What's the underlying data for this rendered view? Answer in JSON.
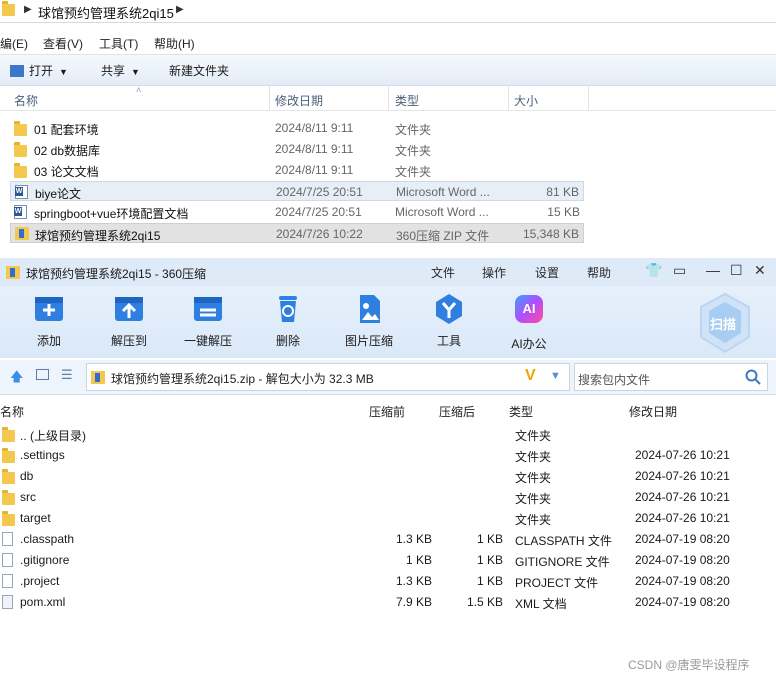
{
  "explorer": {
    "breadcrumb": "球馆预约管理系统2qi15",
    "menu": [
      "编(E)",
      "查看(V)",
      "工具(T)",
      "帮助(H)"
    ],
    "toolbar": {
      "open": "打开",
      "share": "共享",
      "new_folder": "新建文件夹"
    },
    "columns": {
      "name": "名称",
      "date": "修改日期",
      "type": "类型",
      "size": "大小"
    },
    "files": [
      {
        "name": "01 配套环境",
        "date": "2024/8/11 9:11",
        "type": "文件夹",
        "size": "",
        "icon": "folder-icon"
      },
      {
        "name": "02 db数据库",
        "date": "2024/8/11 9:11",
        "type": "文件夹",
        "size": "",
        "icon": "folder-icon"
      },
      {
        "name": "03 论文文档",
        "date": "2024/8/11 9:11",
        "type": "文件夹",
        "size": "",
        "icon": "folder-icon"
      },
      {
        "name": "biye论文",
        "date": "2024/7/25 20:51",
        "type": "Microsoft Word ...",
        "size": "81 KB",
        "icon": "word-doc-icon"
      },
      {
        "name": "springboot+vue环境配置文档",
        "date": "2024/7/25 20:51",
        "type": "Microsoft Word ...",
        "size": "15 KB",
        "icon": "word-doc-icon"
      },
      {
        "name": "球馆预约管理系统2qi15",
        "date": "2024/7/26 10:22",
        "type": "360压缩 ZIP 文件",
        "size": "15,348 KB",
        "icon": "zip-file-icon"
      }
    ]
  },
  "zip": {
    "title": "球馆预约管理系统2qi15 - 360压缩",
    "menu": [
      "文件",
      "操作",
      "设置",
      "帮助"
    ],
    "toolbar": [
      {
        "label": "添加",
        "icon": "add-icon"
      },
      {
        "label": "解压到",
        "icon": "extract-to-icon"
      },
      {
        "label": "一键解压",
        "icon": "one-click-extract-icon"
      },
      {
        "label": "删除",
        "icon": "delete-icon"
      },
      {
        "label": "图片压缩",
        "icon": "image-compress-icon"
      },
      {
        "label": "工具",
        "icon": "tools-icon"
      },
      {
        "label": "AI办公",
        "icon": "ai-office-icon"
      }
    ],
    "scan_label": "扫描",
    "ai_badge": "AI",
    "path_text": "球馆预约管理系统2qi15.zip - 解包大小为 32.3 MB",
    "search_placeholder": "搜索包内文件",
    "columns": {
      "name": "名称",
      "compressed_before": "压缩前",
      "compressed_after": "压缩后",
      "type": "类型",
      "date": "修改日期"
    },
    "files": [
      {
        "name": ".. (上级目录)",
        "before": "",
        "after": "",
        "type": "文件夹",
        "date": "",
        "icon": "folder-icon"
      },
      {
        "name": ".settings",
        "before": "",
        "after": "",
        "type": "文件夹",
        "date": "2024-07-26 10:21",
        "icon": "folder-icon"
      },
      {
        "name": "db",
        "before": "",
        "after": "",
        "type": "文件夹",
        "date": "2024-07-26 10:21",
        "icon": "folder-icon"
      },
      {
        "name": "src",
        "before": "",
        "after": "",
        "type": "文件夹",
        "date": "2024-07-26 10:21",
        "icon": "folder-icon"
      },
      {
        "name": "target",
        "before": "",
        "after": "",
        "type": "文件夹",
        "date": "2024-07-26 10:21",
        "icon": "folder-icon"
      },
      {
        "name": ".classpath",
        "before": "1.3 KB",
        "after": "1 KB",
        "type": "CLASSPATH 文件",
        "date": "2024-07-19 08:20",
        "icon": "file-icon"
      },
      {
        "name": ".gitignore",
        "before": "1 KB",
        "after": "1 KB",
        "type": "GITIGNORE 文件",
        "date": "2024-07-19 08:20",
        "icon": "file-icon"
      },
      {
        "name": ".project",
        "before": "1.3 KB",
        "after": "1 KB",
        "type": "PROJECT 文件",
        "date": "2024-07-19 08:20",
        "icon": "file-icon"
      },
      {
        "name": "pom.xml",
        "before": "7.9 KB",
        "after": "1.5 KB",
        "type": "XML 文档",
        "date": "2024-07-19 08:20",
        "icon": "xml-file-icon"
      }
    ]
  },
  "watermark": "CSDN @唐雯毕设程序"
}
